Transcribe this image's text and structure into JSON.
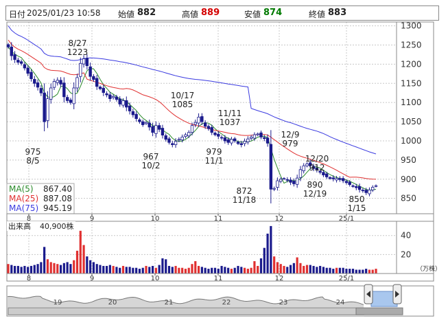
{
  "header": {
    "date_label": "日付",
    "date_value": "2025/01/23 10:58",
    "open_label": "始値",
    "open_value": "882",
    "high_label": "高値",
    "high_value": "889",
    "low_label": "安値",
    "low_value": "874",
    "close_label": "終値",
    "close_value": "883",
    "colors": {
      "high": "#d40000",
      "low": "#007a00",
      "label": "#222222"
    }
  },
  "chart_data": [
    {
      "type": "candlestick",
      "title": "",
      "y_ticks": [
        850,
        900,
        950,
        1000,
        1050,
        1100,
        1150,
        1200,
        1250,
        1300
      ],
      "ylim": [
        810,
        1310
      ],
      "x_tick_labels": [
        "8",
        "9",
        "10",
        "11",
        "12",
        "25/1"
      ],
      "grid": true,
      "close_series": [
        1245,
        1222,
        1212,
        1205,
        1202,
        1190,
        1176,
        1162,
        1150,
        1140,
        1125,
        1050,
        1110,
        1138,
        1155,
        1158,
        1148,
        1115,
        1105,
        1100,
        1138,
        1165,
        1202,
        1214,
        1196,
        1168,
        1160,
        1142,
        1136,
        1126,
        1120,
        1110,
        1116,
        1108,
        1096,
        1105,
        1088,
        1078,
        1068,
        1058,
        1050,
        1042,
        1048,
        1036,
        1022,
        1040,
        1030,
        1015,
        1004,
        996,
        990,
        999,
        1004,
        1010,
        1016,
        1022,
        1040,
        1048,
        1062,
        1050,
        1038,
        1032,
        1022,
        1016,
        1012,
        1008,
        1000,
        996,
        1004,
        1000,
        993,
        990,
        999,
        1005,
        1010,
        1016,
        1018,
        1010,
        1006,
        994,
        874,
        876,
        896,
        900,
        902,
        898,
        892,
        888,
        903,
        925,
        935,
        940,
        935,
        928,
        924,
        918,
        911,
        906,
        902,
        901,
        902,
        899,
        896,
        891,
        886,
        881,
        878,
        873,
        870,
        865,
        872,
        879,
        883
      ],
      "annotations": [
        {
          "type": "high",
          "date": "8/27",
          "value": "1223"
        },
        {
          "type": "low",
          "date": "8/5",
          "value": "975"
        },
        {
          "type": "low",
          "date": "10/2",
          "value": "967"
        },
        {
          "type": "high",
          "date": "10/17",
          "value": "1085"
        },
        {
          "type": "low",
          "date": "11/1",
          "value": "979"
        },
        {
          "type": "high",
          "date": "11/11",
          "value": "1037"
        },
        {
          "type": "low",
          "date": "11/18",
          "value": "872"
        },
        {
          "type": "high",
          "date": "12/9",
          "value": "979"
        },
        {
          "type": "low",
          "date": "12/19",
          "value": "890"
        },
        {
          "type": "high",
          "date": "12/20",
          "value": "912"
        },
        {
          "type": "low",
          "date": "1/15",
          "value": "850"
        }
      ],
      "series": [
        {
          "name": "MA(5)",
          "value": "867.40",
          "color": "#2a8a2a"
        },
        {
          "name": "MA(25)",
          "value": "887.08",
          "color": "#e03030"
        },
        {
          "name": "MA(75)",
          "value": "945.19",
          "color": "#3a3ae0"
        }
      ],
      "colors": {
        "up": "#ffffff",
        "down": "#1a1a8c",
        "outline": "#1a1a8c"
      }
    },
    {
      "type": "bar",
      "title": "出来高",
      "value_label": "40,900株",
      "y_ticks": [
        20,
        40
      ],
      "ylim": [
        0,
        55
      ],
      "unit": "（万株）",
      "x_tick_labels": [
        "8",
        "9",
        "10",
        "11",
        "12",
        "25/1"
      ],
      "values": [
        10,
        9,
        8,
        8,
        7,
        8,
        7,
        8,
        9,
        10,
        12,
        28,
        15,
        12,
        11,
        10,
        9,
        11,
        12,
        10,
        14,
        24,
        45,
        30,
        18,
        14,
        12,
        10,
        9,
        8,
        8,
        9,
        8,
        7,
        6,
        8,
        7,
        7,
        6,
        6,
        5,
        6,
        8,
        7,
        8,
        6,
        9,
        16,
        15,
        8,
        7,
        8,
        6,
        6,
        5,
        6,
        10,
        13,
        8,
        7,
        6,
        5,
        6,
        6,
        5,
        8,
        7,
        6,
        5,
        6,
        8,
        7,
        6,
        5,
        6,
        13,
        8,
        16,
        27,
        42,
        50,
        18,
        12,
        10,
        8,
        7,
        9,
        11,
        17,
        11,
        8,
        9,
        9,
        8,
        7,
        8,
        7,
        6,
        6,
        5,
        6,
        6,
        6,
        5,
        5,
        5,
        4,
        4,
        4,
        5,
        4,
        4,
        5,
        4,
        5,
        4
      ],
      "colors": {
        "up": "#e03030",
        "down": "#1a1a8c"
      }
    },
    {
      "type": "area",
      "x_tick_labels": [
        "19",
        "20",
        "21",
        "22",
        "23",
        "24"
      ],
      "colors": {
        "fill": "#d6d6d6",
        "line": "#777777",
        "selection": "#a9c7ee"
      }
    }
  ]
}
